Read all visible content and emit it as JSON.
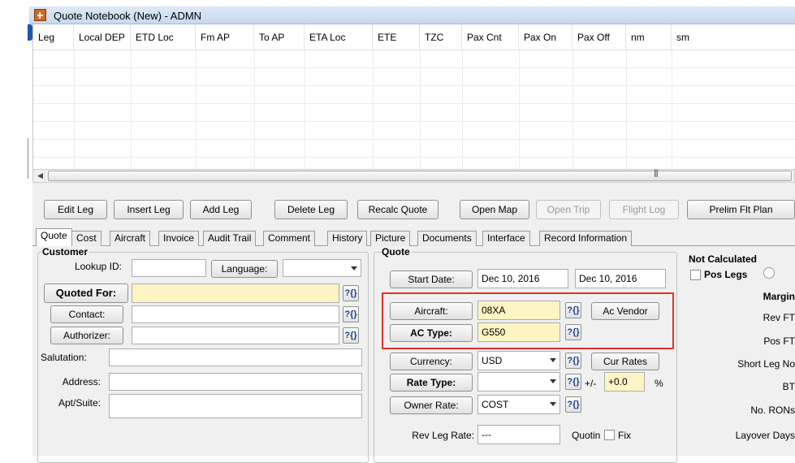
{
  "window": {
    "title": "Quote Notebook (New) - ADMN"
  },
  "grid": {
    "columns": [
      "Leg",
      "Local DEP",
      "ETD Loc",
      "Fm AP",
      "To AP",
      "ETA Loc",
      "ETE",
      "TZC",
      "Pax Cnt",
      "Pax On",
      "Pax Off",
      "nm",
      "sm"
    ]
  },
  "toolbar": {
    "edit_leg": "Edit Leg",
    "insert_leg": "Insert Leg",
    "add_leg": "Add Leg",
    "delete_leg": "Delete Leg",
    "recalc_quote": "Recalc Quote",
    "open_map": "Open Map",
    "open_trip": "Open Trip",
    "flight_log": "Flight Log",
    "prelim_flt_plan": "Prelim Flt Plan"
  },
  "tabs": [
    "Quote",
    "Cost",
    "Aircraft",
    "Invoice",
    "Audit Trail",
    "Comment",
    "History",
    "Picture",
    "Documents",
    "Interface",
    "Record Information"
  ],
  "customer": {
    "group_label": "Customer",
    "lookup_label": "Lookup ID:",
    "lookup_value": "",
    "language_button": "Language:",
    "language_value": "",
    "quoted_for_button": "Quoted For:",
    "quoted_for_value": "",
    "contact_button": "Contact:",
    "contact_value": "",
    "authorizer_button": "Authorizer:",
    "authorizer_value": "",
    "salutation_label": "Salutation:",
    "address_label": "Address:",
    "apt_label": "Apt/Suite:"
  },
  "quote": {
    "group_label": "Quote",
    "start_date_button": "Start Date:",
    "start_date_value": "Dec 10, 2016",
    "end_date_value": "Dec 10, 2016",
    "aircraft_button": "Aircraft:",
    "aircraft_value": "08XA",
    "ac_vendor_button": "Ac Vendor",
    "ac_type_button": "AC Type:",
    "ac_type_value": "G550",
    "currency_button": "Currency:",
    "currency_value": "USD",
    "cur_rates_button": "Cur Rates",
    "rate_type_button": "Rate Type:",
    "rate_type_value": "",
    "plus_minus": "+/-",
    "pct_value": "+0.0",
    "pct_sign": "%",
    "owner_rate_button": "Owner Rate:",
    "owner_rate_value": "COST",
    "rev_leg_rate_label": "Rev Leg Rate:",
    "rev_leg_rate_value": "---",
    "quoting_label": "Quotin",
    "fix_label": "Fix",
    "lookup_glyph": "?{}"
  },
  "not_calculated": {
    "title": "Not Calculated",
    "pos_legs": "Pos Legs",
    "margin": "Margin",
    "rev_ft": "Rev FT",
    "pos_ft": "Pos FT",
    "short_leg": "Short Leg No",
    "bt": "BT",
    "no_rons": "No. RONs",
    "layover": "Layover Days"
  },
  "colors": {
    "highlight_box": "#e0312e",
    "required_field": "#fff5c4",
    "titlebar": "#c7d9ef"
  }
}
